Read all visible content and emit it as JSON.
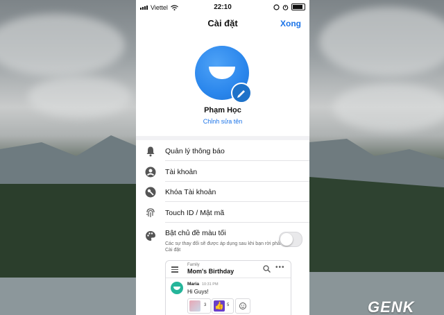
{
  "status_bar": {
    "carrier": "Viettel",
    "time": "22:10"
  },
  "nav": {
    "title": "Cài đặt",
    "done_label": "Xong"
  },
  "profile": {
    "name": "Phạm Học",
    "edit_name_label": "Chỉnh sửa tên"
  },
  "settings": {
    "items": [
      {
        "label": "Quản lý thông báo",
        "icon": "bell-icon"
      },
      {
        "label": "Tài khoản",
        "icon": "account-icon"
      },
      {
        "label": "Khóa Tài khoản",
        "icon": "key-icon"
      },
      {
        "label": "Touch ID / Mật mã",
        "icon": "fingerprint-icon"
      }
    ],
    "dark_theme": {
      "label": "Bật chủ đề màu tối",
      "description": "Các sự thay đổi sẽ được áp dụng sau khi bạn rời phần Cài đặt",
      "icon": "palette-icon",
      "enabled": false
    }
  },
  "preview": {
    "group": "Family",
    "title": "Mom's Birthday",
    "sender": "Maria",
    "time": "10:31 PM",
    "message": "Hi Guys!",
    "reactions": [
      {
        "icon": "photo-thumbnail-icon",
        "count": "3"
      },
      {
        "icon": "thumbs-up-icon",
        "count": "5"
      },
      {
        "icon": "add-reaction-icon",
        "count": ""
      }
    ]
  },
  "watermark": "GENK",
  "colors": {
    "accent": "#1a73e8",
    "avatar_blue": "#2a86ec",
    "preview_avatar": "#25b59a"
  }
}
